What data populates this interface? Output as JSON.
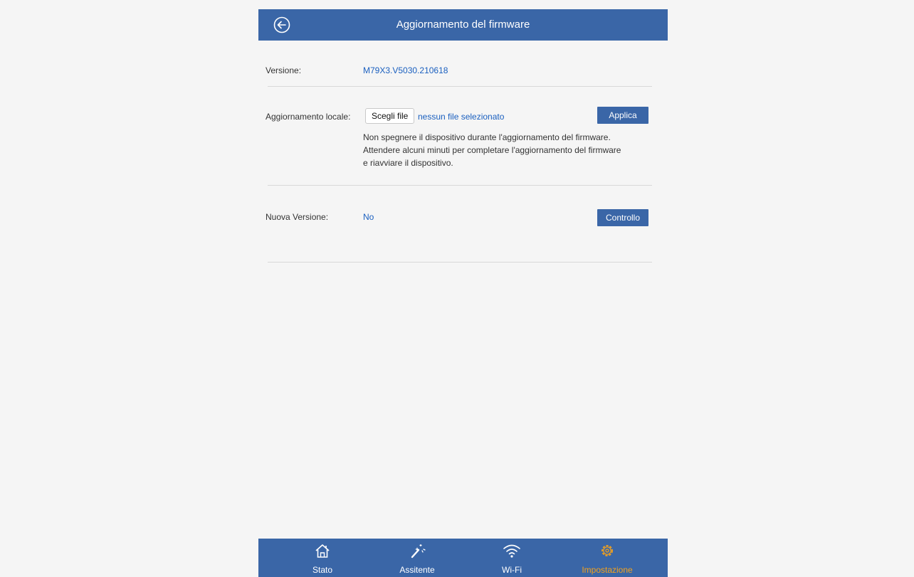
{
  "header": {
    "title": "Aggiornamento del firmware",
    "back_icon": "arrow-left-circle-icon"
  },
  "version": {
    "label": "Versione:",
    "value": "M79X3.V5030.210618"
  },
  "local_update": {
    "label": "Aggiornamento locale:",
    "choose_file_label": "Scegli file",
    "file_status": "nessun file selezionato",
    "apply_label": "Applica",
    "note_lines": [
      "Non spegnere il dispositivo durante l'aggiornamento del firmware.",
      "Attendere alcuni minuti per completare l'aggiornamento del firmware",
      "e riavviare il dispositivo."
    ]
  },
  "new_version": {
    "label": "Nuova Versione:",
    "value": "No",
    "check_label": "Controllo"
  },
  "bottom_nav": {
    "items": [
      {
        "label": "Stato",
        "icon": "home-icon",
        "active": false
      },
      {
        "label": "Assitente",
        "icon": "magic-wand-icon",
        "active": false
      },
      {
        "label": "Wi-Fi",
        "icon": "wifi-icon",
        "active": false
      },
      {
        "label": "Impostazione",
        "icon": "gear-icon",
        "active": true
      }
    ]
  },
  "colors": {
    "header_bg": "#3a66a7",
    "accent_blue": "#1a5fbf",
    "active_nav": "#f5a21b",
    "page_bg": "#f5f5f5"
  }
}
